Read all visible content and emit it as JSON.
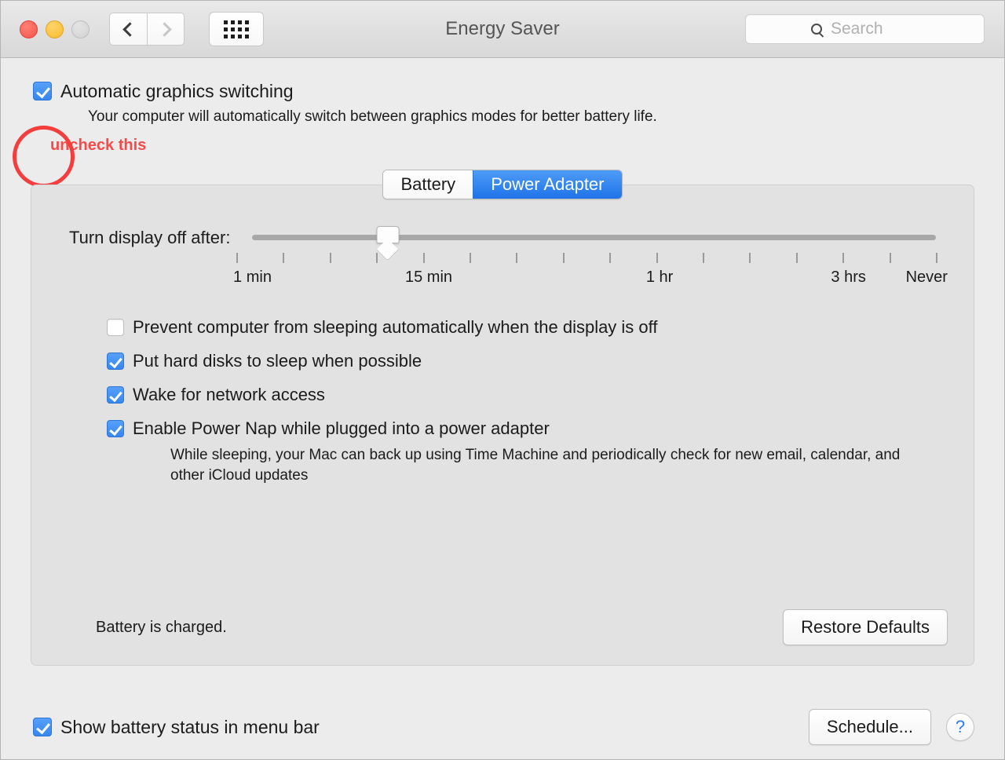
{
  "titlebar": {
    "title": "Energy Saver",
    "back_icon": "chevron-left-icon",
    "forward_icon": "chevron-right-icon",
    "grid_icon": "show-all-grid-icon",
    "search_placeholder": "Search",
    "search_value": "",
    "search_icon": "search-icon"
  },
  "graphics": {
    "checkbox_label": "Automatic graphics switching",
    "checked": true,
    "description": "Your computer will automatically switch between graphics modes for better battery life."
  },
  "annotation": {
    "text": "uncheck this",
    "color": "#f94a4a",
    "circle_color": "#f43d3d"
  },
  "tabs": [
    {
      "label": "Battery",
      "active": false
    },
    {
      "label": "Power Adapter",
      "active": true
    }
  ],
  "slider": {
    "label": "Turn display off after:",
    "value_label": "15 min",
    "tick_count": 16,
    "tick_labels": [
      {
        "text": "1 min",
        "pos": 2.3
      },
      {
        "text": "15 min",
        "pos": 27.5
      },
      {
        "text": "1 hr",
        "pos": 60.5
      },
      {
        "text": "3 hrs",
        "pos": 87.5
      },
      {
        "text": "Never",
        "pos": 100
      }
    ]
  },
  "options": [
    {
      "label": "Prevent computer from sleeping automatically when the display is off",
      "checked": false,
      "description": ""
    },
    {
      "label": "Put hard disks to sleep when possible",
      "checked": true,
      "description": ""
    },
    {
      "label": "Wake for network access",
      "checked": true,
      "description": ""
    },
    {
      "label": "Enable Power Nap while plugged into a power adapter",
      "checked": true,
      "description": "While sleeping, your Mac can back up using Time Machine and periodically check for new email, calendar, and other iCloud updates"
    }
  ],
  "panel_bottom": {
    "battery_status": "Battery is charged.",
    "restore_defaults_label": "Restore Defaults"
  },
  "bottom": {
    "show_battery_label": "Show battery status in menu bar",
    "show_battery_checked": true,
    "schedule_label": "Schedule...",
    "help_label": "?"
  },
  "colors": {
    "accent_blue": "#3787ef",
    "window_bg": "#ececec",
    "panel_bg": "#e2e2e2"
  }
}
